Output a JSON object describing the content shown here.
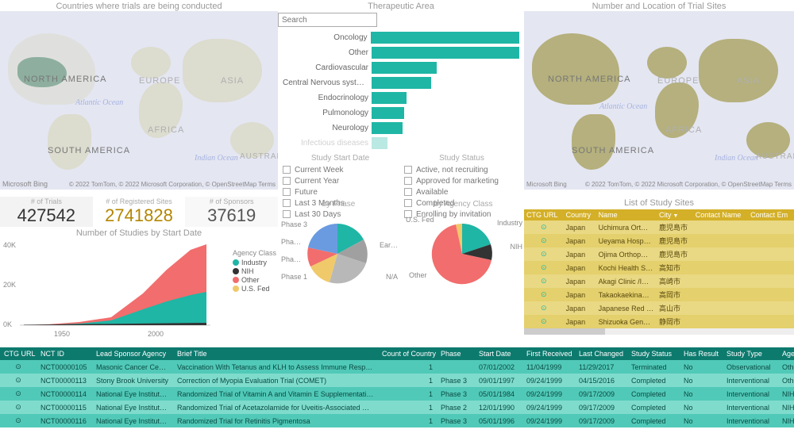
{
  "left_map": {
    "title": "Countries where trials are being conducted",
    "north_america": "NORTH AMERICA",
    "south_america": "SOUTH AMERICA",
    "europe": "EUROPE",
    "asia": "ASIA",
    "africa": "AFRICA",
    "austral": "AUSTRAL",
    "atlantic": "Atlantic Ocean",
    "indian": "Indian Ocean",
    "bing": "Microsoft Bing",
    "credit": "© 2022 TomTom, © 2022 Microsoft Corporation, © OpenStreetMap  Terms"
  },
  "right_map": {
    "title": "Number and Location of Trial Sites",
    "north_america": "NORTH AMERICA",
    "south_america": "SOUTH AMERICA",
    "europe": "EUROPE",
    "asia": "ASIA",
    "africa": "AFRICA",
    "austral": "AUSTRAL",
    "atlantic": "Atlantic Ocean",
    "indian": "Indian Ocean",
    "bing": "Microsoft Bing",
    "credit": "© 2022 TomTom, © 2022 Microsoft Corporation, © OpenStreetMap  Terms"
  },
  "cards": {
    "trials_label": "# of Trials",
    "trials_value": "427542",
    "sites_label": "# of Registered Sites",
    "sites_value": "2741828",
    "sponsors_label": "# of Sponsors",
    "sponsors_value": "37619"
  },
  "area_chart_title": "Number of Studies by Start Date",
  "area_chart_legend_title": "Agency Class",
  "area_legend": {
    "industry": "Industry",
    "nih": "NIH",
    "other": "Other",
    "usfed": "U.S. Fed"
  },
  "chart_data": {
    "area": {
      "type": "area",
      "title": "Number of Studies by Start Date",
      "xlabel": "",
      "ylabel": "",
      "x_ticks": [
        "1950",
        "2000"
      ],
      "y_ticks": [
        "0K",
        "20K",
        "40K"
      ],
      "ylim": [
        0,
        40000
      ],
      "series": [
        {
          "name": "Industry",
          "color": "#1fb6a5"
        },
        {
          "name": "NIH",
          "color": "#333333"
        },
        {
          "name": "Other",
          "color": "#f26d6d"
        },
        {
          "name": "U.S. Fed",
          "color": "#f0c96a"
        }
      ],
      "stacked_totals": {
        "1950": 100,
        "1970": 800,
        "1985": 2500,
        "1995": 6000,
        "2005": 20000,
        "2015": 35000,
        "2022": 40000
      }
    },
    "hbar": {
      "type": "bar",
      "title": "Therapeutic Area",
      "orientation": "horizontal",
      "xlim": [
        0,
        200
      ],
      "categories": [
        "Oncology",
        "Other",
        "Cardiovascular",
        "Central Nervous syste…",
        "Endocrinology",
        "Pulmonology",
        "Neurology",
        "Infectious diseases"
      ],
      "values": [
        200,
        195,
        85,
        78,
        45,
        42,
        40,
        20
      ]
    },
    "phase_pie": {
      "type": "pie",
      "title": "by Phase",
      "slices": [
        {
          "label": "Phase 3",
          "value": 18,
          "color": "#1fb6a5"
        },
        {
          "label": "Ear…",
          "value": 15,
          "color": "#a0a0a0"
        },
        {
          "label": "N/A",
          "value": 30,
          "color": "#b8b8b8"
        },
        {
          "label": "Phase 1",
          "value": 12,
          "color": "#f0c96a"
        },
        {
          "label": "Pha…",
          "value": 7,
          "color": "#f26d6d"
        },
        {
          "label": "Pha…",
          "value": 18,
          "color": "#6a9be0"
        }
      ]
    },
    "agency_pie": {
      "type": "pie",
      "title": "by Agency Class",
      "slices": [
        {
          "label": "Industry",
          "value": 30,
          "color": "#1fb6a5"
        },
        {
          "label": "NIH",
          "value": 5,
          "color": "#333333"
        },
        {
          "label": "Other",
          "value": 62,
          "color": "#f26d6d"
        },
        {
          "label": "U.S. Fed",
          "value": 3,
          "color": "#f0c96a"
        }
      ]
    }
  },
  "center": {
    "title": "Therapeutic Area",
    "search_placeholder": "Search"
  },
  "filters": {
    "start_title": "Study Start Date",
    "start_items": [
      "Current Week",
      "Current Year",
      "Future",
      "Last 3 Months",
      "Last 30 Days"
    ],
    "status_title": "Study Status",
    "status_items": [
      "Active, not recruiting",
      "Approved for marketing",
      "Available",
      "Completed",
      "Enrolling by invitation"
    ]
  },
  "pies": {
    "phase_title": "by Phase",
    "agency_title": "by Agency Class",
    "phase3": "Phase 3",
    "pha1": "Pha…",
    "pha2": "Pha…",
    "phase1": "Phase 1",
    "ear": "Ear…",
    "na": "N/A",
    "usfed": "U.S. Fed",
    "industry": "Industry",
    "nih": "NIH",
    "other": "Other"
  },
  "sites": {
    "title": "List of Study Sites",
    "cols": [
      "CTG URL",
      "Country",
      "Name",
      "City",
      "Contact Name",
      "Contact Em"
    ],
    "rows": [
      [
        "Japan",
        "Uchimura Ort…",
        "鹿児島市"
      ],
      [
        "Japan",
        "Ueyama Hosp…",
        "鹿児島市"
      ],
      [
        "Japan",
        "Ojima Orthop…",
        "鹿児島市"
      ],
      [
        "Japan",
        "Kochi Health S…",
        "高知市"
      ],
      [
        "Japan",
        "Akagi Clinic /I…",
        "高崎市"
      ],
      [
        "Japan",
        "Takaokaekina…",
        "高岡市"
      ],
      [
        "Japan",
        "Japanese Red …",
        "高山市"
      ],
      [
        "Japan",
        "Shizuoka Gen…",
        "静岡市"
      ]
    ]
  },
  "bottom": {
    "cols": [
      "CTG URL",
      "NCT ID",
      "Lead Sponsor Agency",
      "Brief Title",
      "Count of Country",
      "Phase",
      "Start Date",
      "First Received",
      "Last Changed",
      "Study Status",
      "Has Result",
      "Study Type",
      "Agency"
    ],
    "rows": [
      {
        "nct": "NCT00000105",
        "sponsor": "Masonic Cancer Cente…",
        "title": "Vaccination With Tetanus and KLH to Assess Immune Responses.",
        "cc": "1",
        "phase": "",
        "start": "07/01/2002",
        "first": "11/04/1999",
        "last": "11/29/2017",
        "status": "Terminated",
        "has": "No",
        "type": "Observational",
        "agency": "Other"
      },
      {
        "nct": "NCT00000113",
        "sponsor": "Stony Brook University",
        "title": "Correction of Myopia Evaluation Trial (COMET)",
        "cc": "1",
        "phase": "Phase 3",
        "start": "09/01/1997",
        "first": "09/24/1999",
        "last": "04/15/2016",
        "status": "Completed",
        "has": "No",
        "type": "Interventional",
        "agency": "Other"
      },
      {
        "nct": "NCT00000114",
        "sponsor": "National Eye Institute (…",
        "title": "Randomized Trial of Vitamin A and Vitamin E Supplementation for…",
        "cc": "1",
        "phase": "Phase 3",
        "start": "05/01/1984",
        "first": "09/24/1999",
        "last": "09/17/2009",
        "status": "Completed",
        "has": "No",
        "type": "Interventional",
        "agency": "NIH"
      },
      {
        "nct": "NCT00000115",
        "sponsor": "National Eye Institute (…",
        "title": "Randomized Trial of Acetazolamide for Uveitis-Associated Cystoid…",
        "cc": "1",
        "phase": "Phase 2",
        "start": "12/01/1990",
        "first": "09/24/1999",
        "last": "09/17/2009",
        "status": "Completed",
        "has": "No",
        "type": "Interventional",
        "agency": "NIH"
      },
      {
        "nct": "NCT00000116",
        "sponsor": "National Eye Institute (…",
        "title": "Randomized Trial for Retinitis Pigmentosa",
        "cc": "1",
        "phase": "Phase 3",
        "start": "05/01/1996",
        "first": "09/24/1999",
        "last": "09/17/2009",
        "status": "Completed",
        "has": "No",
        "type": "Interventional",
        "agency": "NIH"
      }
    ]
  },
  "colors": {
    "teal": "#1fb6a5",
    "red": "#f26d6d",
    "black": "#333333",
    "yellow": "#f0c96a"
  },
  "axis": {
    "yk40": "40K",
    "yk20": "20K",
    "yk0": "0K",
    "x1950": "1950",
    "x2000": "2000"
  }
}
